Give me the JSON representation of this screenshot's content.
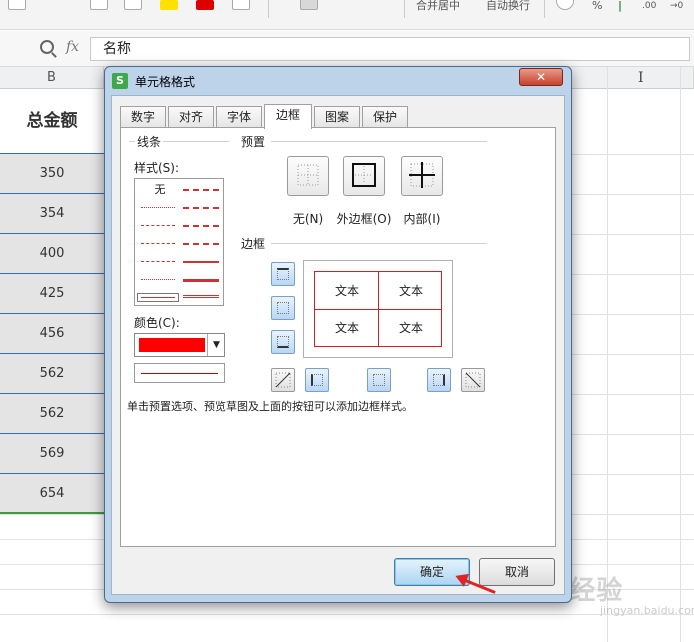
{
  "toolbar": {
    "merge_label": "合并居中",
    "wrap_label": "自动换行",
    "percent_label": "%",
    "decimal_inc_label": ".00",
    "decimal_dec_label": "→0"
  },
  "formula_bar": {
    "fx_label": "fx",
    "cell_content": "名称"
  },
  "sheet": {
    "column_header": "B",
    "right_column_header": "I",
    "header_cell": "总金额",
    "values": [
      "350",
      "354",
      "400",
      "425",
      "456",
      "562",
      "562",
      "569",
      "654"
    ]
  },
  "dialog": {
    "title": "单元格格式",
    "tabs": [
      {
        "label": "数字"
      },
      {
        "label": "对齐"
      },
      {
        "label": "字体"
      },
      {
        "label": "边框"
      },
      {
        "label": "图案"
      },
      {
        "label": "保护"
      }
    ],
    "active_tab": "边框",
    "line_group": "线条",
    "style_label": "样式(S):",
    "style_none": "无",
    "color_label": "颜色(C):",
    "color_value": "#ff0000",
    "preset_group": "预置",
    "presets": [
      {
        "label": "无(N)"
      },
      {
        "label": "外边框(O)"
      },
      {
        "label": "内部(I)"
      }
    ],
    "border_group": "边框",
    "preview_text": [
      "文本",
      "文本",
      "文本",
      "文本"
    ],
    "hint": "单击预置选项、预览草图及上面的按钮可以添加边框样式。",
    "ok_label": "确定",
    "cancel_label": "取消"
  },
  "watermark": {
    "brand": "Bai经验",
    "sub": "jingyan.baidu.com"
  },
  "colors": {
    "accent_blue": "#2f6db5",
    "border_red": "#d21f1f",
    "arrow_red": "#e02424"
  }
}
